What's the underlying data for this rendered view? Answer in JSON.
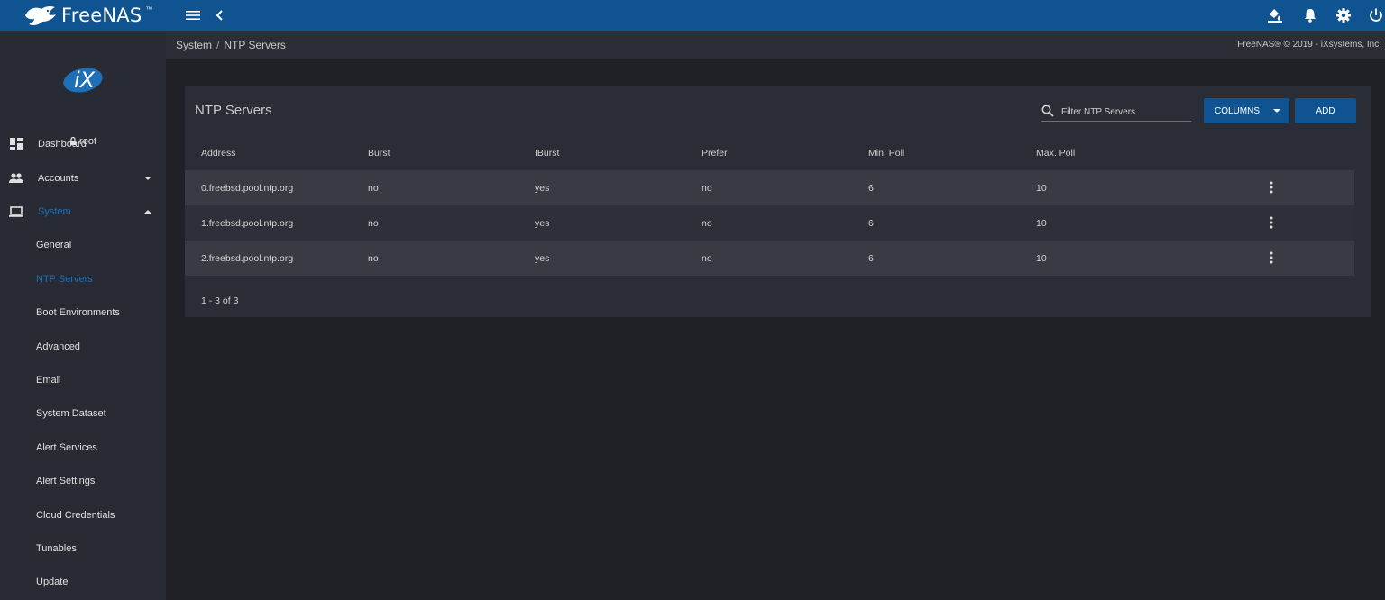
{
  "app": {
    "name": "FreeNAS",
    "trademark": "™"
  },
  "topbar": {
    "icons": [
      "menu-icon",
      "chevron-left-icon",
      "update-icon",
      "bell-icon",
      "gear-icon",
      "power-icon"
    ]
  },
  "sidebar": {
    "user": "root",
    "items": [
      {
        "label": "Dashboard",
        "icon": "dashboard-icon"
      },
      {
        "label": "Accounts",
        "icon": "accounts-icon"
      },
      {
        "label": "System",
        "icon": "laptop-icon"
      }
    ],
    "system_children": [
      "General",
      "NTP Servers",
      "Boot Environments",
      "Advanced",
      "Email",
      "System Dataset",
      "Alert Services",
      "Alert Settings",
      "Cloud Credentials",
      "Tunables",
      "Update"
    ],
    "active_item": "System",
    "active_child": "NTP Servers"
  },
  "breadcrumb": {
    "parent": "System",
    "separator": "/",
    "current": "NTP Servers"
  },
  "copyright": "FreeNAS® © 2019 - iXsystems, Inc.",
  "card": {
    "title": "NTP Servers",
    "search_placeholder": "Filter NTP Servers",
    "columns_label": "COLUMNS",
    "add_label": "ADD"
  },
  "table": {
    "headers": [
      "Address",
      "Burst",
      "IBurst",
      "Prefer",
      "Min. Poll",
      "Max. Poll"
    ],
    "rows": [
      [
        "0.freebsd.pool.ntp.org",
        "no",
        "yes",
        "no",
        "6",
        "10"
      ],
      [
        "1.freebsd.pool.ntp.org",
        "no",
        "yes",
        "no",
        "6",
        "10"
      ],
      [
        "2.freebsd.pool.ntp.org",
        "no",
        "yes",
        "no",
        "6",
        "10"
      ]
    ]
  },
  "paginator": "1 - 3 of 3",
  "colors": {
    "primary": "#0f5490",
    "active": "#1d6fb8",
    "background": "#1f2127",
    "sidebar": "#282b33",
    "card": "#2a2d35"
  }
}
